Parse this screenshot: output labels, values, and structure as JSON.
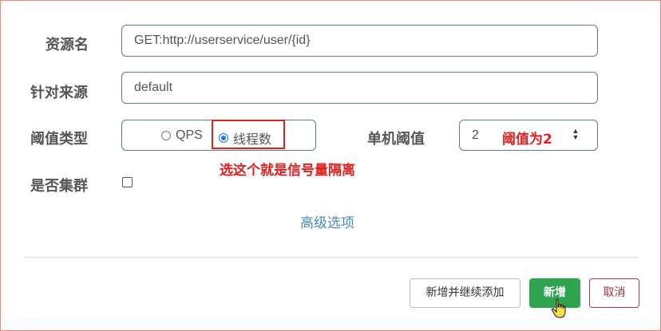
{
  "form": {
    "resource_label": "资源名",
    "resource_value": "GET:http://userservice/user/{id}",
    "limit_app_label": "针对来源",
    "limit_app_value": "default",
    "grade_label": "阈值类型",
    "grade_options": [
      {
        "label": "QPS",
        "checked": false
      },
      {
        "label": "线程数",
        "checked": true
      }
    ],
    "count_label": "单机阈值",
    "count_value": "2",
    "cluster_label": "是否集群",
    "cluster_checked": false,
    "advanced_link": "高级选项"
  },
  "annotations": {
    "isolation_note": "选这个就是信号量隔离",
    "threshold_note": "阈值为2",
    "color": "#e02020"
  },
  "footer": {
    "add_continue_label": "新增并继续添加",
    "add_label": "新增",
    "cancel_label": "取消"
  },
  "colors": {
    "primary": "#2ea44f",
    "cancel": "#a03040",
    "link": "#4a8cb8",
    "radio_checked": "#1a73e8"
  },
  "icons": [
    "radio-unchecked-icon",
    "radio-checked-icon",
    "spinner-arrows-icon",
    "checkbox-icon",
    "hand-pointer-icon"
  ]
}
